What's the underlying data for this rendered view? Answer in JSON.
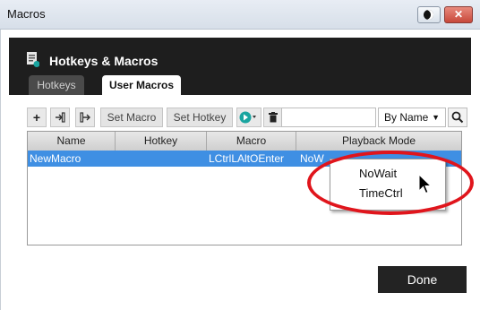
{
  "window": {
    "title": "Macros",
    "close_glyph": "✕"
  },
  "header": {
    "title": "Hotkeys & Macros",
    "tabs": [
      {
        "label": "Hotkeys",
        "active": false
      },
      {
        "label": "User Macros",
        "active": true
      }
    ]
  },
  "toolbar": {
    "add_glyph": "+",
    "set_macro": "Set Macro",
    "set_hotkey": "Set Hotkey",
    "search_value": "",
    "sort_by": "By Name",
    "icons": [
      "add-icon",
      "import-icon",
      "export-icon",
      "play-icon",
      "delete-icon",
      "search-icon"
    ]
  },
  "table": {
    "columns": [
      "Name",
      "Hotkey",
      "Macro",
      "Playback Mode"
    ],
    "rows": [
      {
        "name": "NewMacro",
        "hotkey": "",
        "macro": "LCtrlLAltOEnter",
        "playback": "NoW"
      }
    ]
  },
  "popup": {
    "items": [
      "NoWait",
      "TimeCtrl"
    ]
  },
  "footer": {
    "done_label": "Done"
  },
  "colors": {
    "header_bg": "#1e1e1e",
    "selection": "#3f8fe3",
    "highlight_circle": "#e0151c",
    "play_green": "#1aa5a0"
  }
}
